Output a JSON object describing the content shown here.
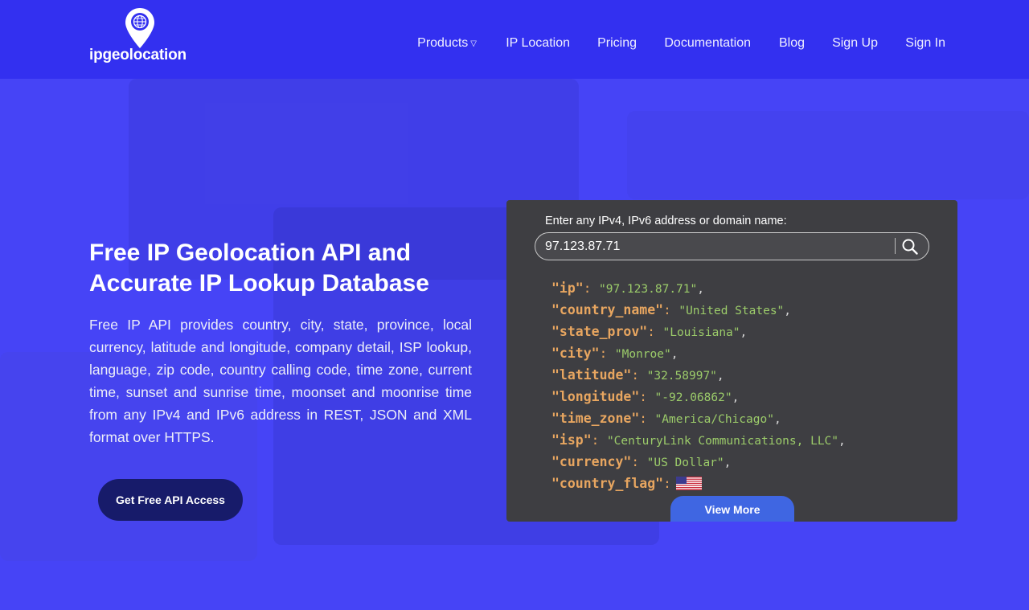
{
  "brand": {
    "name": "ipgeolocation"
  },
  "nav": {
    "items": [
      {
        "label": "Products",
        "has_dropdown": true
      },
      {
        "label": "IP Location"
      },
      {
        "label": "Pricing"
      },
      {
        "label": "Documentation"
      },
      {
        "label": "Blog"
      },
      {
        "label": "Sign Up"
      },
      {
        "label": "Sign In"
      }
    ]
  },
  "hero": {
    "headline": "Free IP Geolocation API and Accurate IP Lookup Database",
    "description": "Free IP API provides country, city, state, province, local currency, latitude and longitude, company detail, ISP lookup, language, zip code, country calling code, time zone, current time, sunset and sunrise time, moonset and moonrise time from any IPv4 and IPv6 address in REST, JSON and XML format over HTTPS.",
    "cta_label": "Get Free API Access"
  },
  "lookup": {
    "label": "Enter any IPv4, IPv6 address or domain name:",
    "input_value": "97.123.87.71",
    "result": [
      {
        "key": "\"ip\"",
        "value": "\"97.123.87.71\""
      },
      {
        "key": "\"country_name\"",
        "value": "\"United States\""
      },
      {
        "key": "\"state_prov\"",
        "value": "\"Louisiana\""
      },
      {
        "key": "\"city\"",
        "value": "\"Monroe\""
      },
      {
        "key": "\"latitude\"",
        "value": "\"32.58997\""
      },
      {
        "key": "\"longitude\"",
        "value": "\"-92.06862\""
      },
      {
        "key": "\"time_zone\"",
        "value": "\"America/Chicago\""
      },
      {
        "key": "\"isp\"",
        "value": "\"CenturyLink Communications, LLC\""
      },
      {
        "key": "\"currency\"",
        "value": "\"US Dollar\""
      },
      {
        "key": "\"country_flag\"",
        "flag": "us-flag"
      }
    ],
    "view_more_label": "View More"
  },
  "icons": {
    "logo": "map-pin-globe-icon",
    "nav_caret": "caret-down-icon",
    "search": "search-icon",
    "flag": "us-flag-icon"
  },
  "colors": {
    "header_bg": "#3330f0",
    "hero_bg": "#4644f6",
    "panel_bg": "#3e3e42",
    "json_key": "#e8a660",
    "json_value": "#9ccc6a",
    "cta_bg": "#171b6a",
    "view_more_bg": "#3f66e2"
  }
}
